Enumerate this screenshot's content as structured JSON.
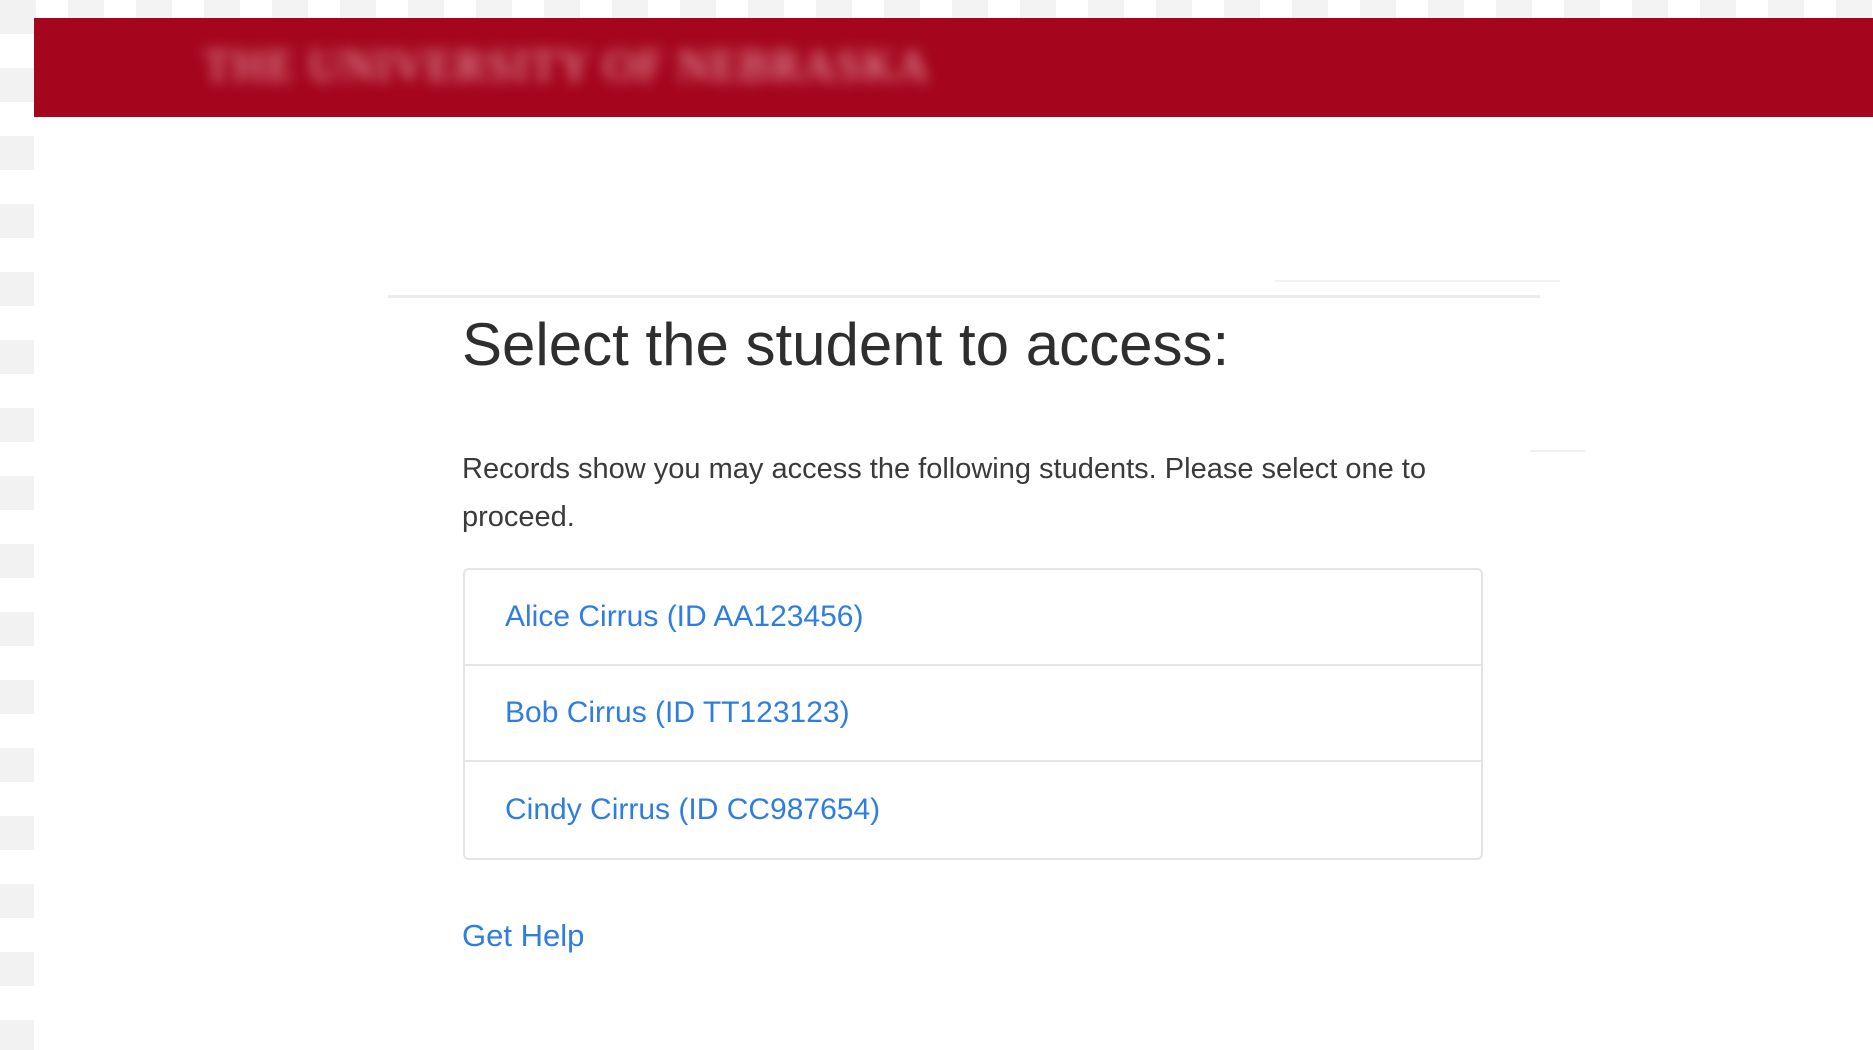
{
  "header": {
    "brand_text": "THE UNIVERSITY OF NEBRASKA",
    "color": "#a5061e"
  },
  "main": {
    "title": "Select the student to access:",
    "intro": "Records show you may access the following students. Please select one to proceed.",
    "students": [
      {
        "label": "Alice Cirrus (ID AA123456)"
      },
      {
        "label": "Bob Cirrus (ID TT123123)"
      },
      {
        "label": "Cindy Cirrus (ID CC987654)"
      }
    ],
    "help_label": "Get Help",
    "link_color": "#2f7de1"
  }
}
